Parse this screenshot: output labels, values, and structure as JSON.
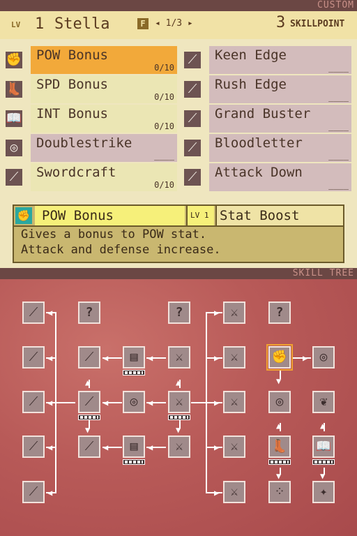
{
  "screen_top": {
    "bar_label": "CUSTOM",
    "header": {
      "lv_tag": "LV",
      "level": "1",
      "name": "Stella",
      "f_badge": "F",
      "page": "◂ 1/3 ▸",
      "skill_points": "3",
      "skill_points_label": "SKILLPOINT"
    },
    "skills_left": [
      {
        "name": "POW Bonus",
        "count": "0/10",
        "icon": "fist-icon",
        "selected": true
      },
      {
        "name": "SPD Bonus",
        "count": "0/10",
        "icon": "boot-icon"
      },
      {
        "name": "INT Bonus",
        "count": "0/10",
        "icon": "book-icon"
      },
      {
        "name": "Doublestrike",
        "count": "____",
        "icon": "ring-icon"
      },
      {
        "name": "Swordcraft",
        "count": "0/10",
        "icon": "sword-icon"
      }
    ],
    "skills_right": [
      {
        "name": "Keen Edge",
        "count": "____",
        "icon": "sword-icon"
      },
      {
        "name": "Rush Edge",
        "count": "____",
        "icon": "sword-icon"
      },
      {
        "name": "Grand Buster",
        "count": "____",
        "icon": "sword-icon"
      },
      {
        "name": "Bloodletter",
        "count": "____",
        "icon": "sword-icon"
      },
      {
        "name": "Attack Down",
        "count": "____",
        "icon": "sword-icon"
      }
    ],
    "description": {
      "name": "POW Bonus",
      "lv_label": "LV 1",
      "type": "Stat Boost",
      "line1": "Gives a bonus to POW stat.",
      "line2": "Attack and defense increase."
    }
  },
  "screen_bottom": {
    "bar_label": "SKILL TREE",
    "colors": {
      "node": "#a08a8a",
      "current": "#f0a030",
      "background": "#b85a58"
    }
  }
}
